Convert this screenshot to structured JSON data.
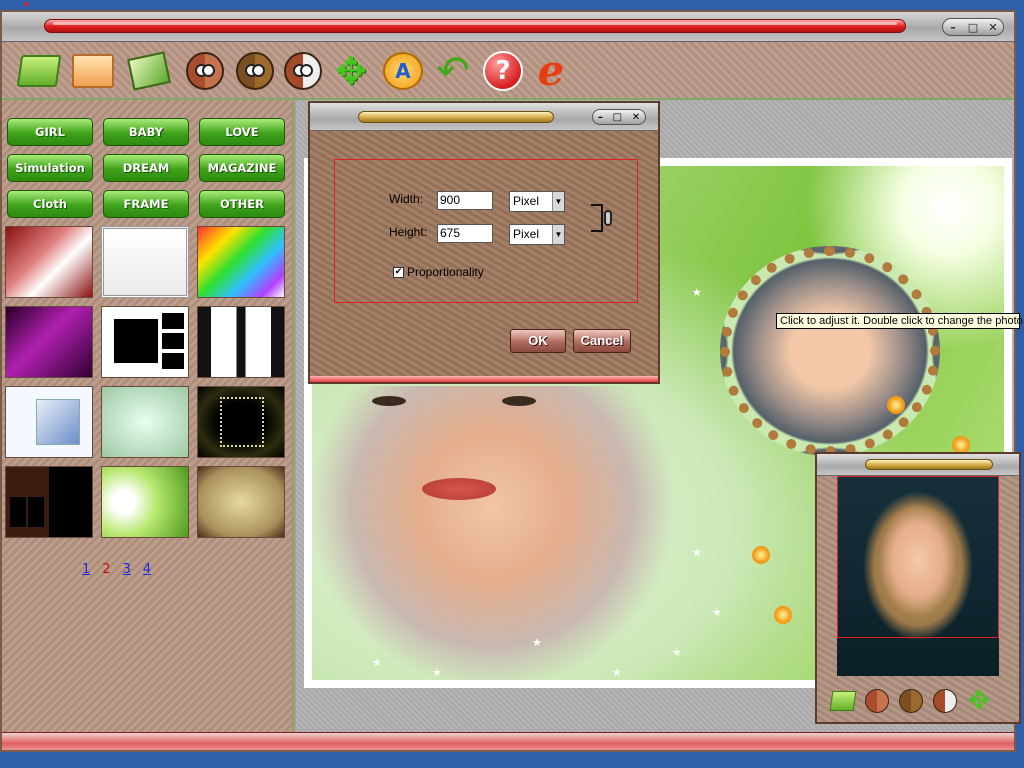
{
  "app": {
    "window_controls": [
      "–",
      "□",
      "✕"
    ]
  },
  "toolbar": {
    "icons": [
      "folder-open-icon",
      "open-box-icon",
      "picture-icon",
      "face-brown-icon",
      "face-olive-icon",
      "face-white-icon",
      "move-arrows-icon",
      "text-icon",
      "undo-icon",
      "help-icon",
      "internet-explorer-icon"
    ]
  },
  "categories": [
    "GIRL",
    "BABY",
    "LOVE",
    "Simulation",
    "DREAM",
    "MAGAZINE",
    "Cloth",
    "FRAME",
    "OTHER"
  ],
  "pager": {
    "pages": [
      "1",
      "2",
      "3",
      "4"
    ],
    "current": "2"
  },
  "dialog": {
    "width_label": "Width:",
    "width_value": "900",
    "height_label": "Height:",
    "height_value": "675",
    "unit_width": "Pixel",
    "unit_height": "Pixel",
    "proportionality_label": "Proportionality",
    "proportionality_checked": true,
    "ok_label": "OK",
    "cancel_label": "Cancel",
    "controls": [
      "–",
      "□",
      "✕"
    ]
  },
  "tooltip": "Click to adjust it. Double click to change the photo.",
  "colors": {
    "category_button": "#3ea31a",
    "title_bar": "#e42424",
    "dialog_border": "#e02020",
    "link": "#1a2ae0",
    "current_page": "#c01010"
  }
}
